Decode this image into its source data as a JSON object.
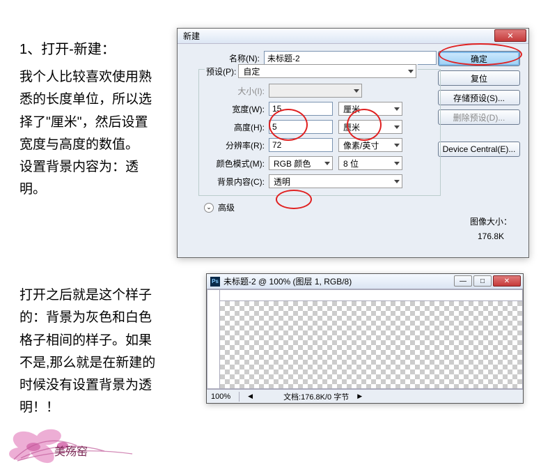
{
  "text": {
    "heading": "1、打开-新建：",
    "para1": "我个人比较喜欢使用熟悉的长度单位，所以选择了\"厘米\"，然后设置宽度与高度的数值。\n设置背景内容为：透明。",
    "para2": "打开之后就是这个样子的：背景为灰色和白色格子相间的样子。如果不是,那么就是在新建的时候没有设置背景为透明！！"
  },
  "dialog": {
    "title": "新建",
    "labels": {
      "name": "名称(N):",
      "preset": "预设(P):",
      "size": "大小(I):",
      "width": "宽度(W):",
      "height": "高度(H):",
      "resolution": "分辨率(R):",
      "colormode": "颜色模式(M):",
      "bgcontent": "背景内容(C):",
      "advanced": "高级",
      "imagesize_lbl": "图像大小：",
      "imagesize_val": "176.8K"
    },
    "values": {
      "name": "未标题-2",
      "preset": "自定",
      "width": "15",
      "width_unit": "厘米",
      "height": "5",
      "height_unit": "厘米",
      "resolution": "72",
      "resolution_unit": "像素/英寸",
      "colormode": "RGB 颜色",
      "bitdepth": "8 位",
      "bgcontent": "透明"
    },
    "buttons": {
      "ok": "确定",
      "reset": "复位",
      "save_preset": "存储预设(S)...",
      "delete_preset": "删除预设(D)...",
      "device_central": "Device Central(E)..."
    }
  },
  "docwin": {
    "title": "未标题-2 @ 100% (图层 1, RGB/8)",
    "zoom": "100%",
    "docinfo": "文档:176.8K/0 字节"
  }
}
